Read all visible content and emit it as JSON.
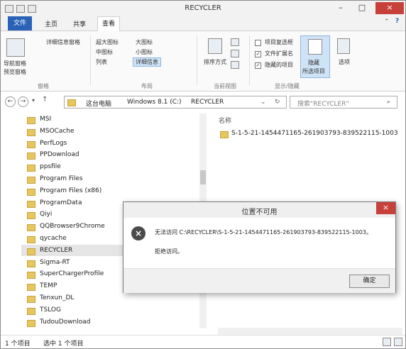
{
  "window": {
    "title": "RECYCLER",
    "min_label": "–",
    "max_label": "□",
    "close_label": "×"
  },
  "ribbon_tabs": {
    "file": "文件",
    "home": "主页",
    "share": "共享",
    "view": "查看"
  },
  "ribbon": {
    "nav_pane": "导航窗格",
    "preview_pane": "预览窗格",
    "details_pane": "详细信息窗格",
    "panes_group": "窗格",
    "layout": [
      "超大图标",
      "大图标",
      "中图标",
      "小图标",
      "列表",
      "详细信息"
    ],
    "layout_group": "布局",
    "sort_by": "排序方式",
    "current_view_group": "当前视图",
    "checkbox_items": "项目复选框",
    "file_extensions": "文件扩展名",
    "hidden_items": "隐藏的项目",
    "hide_label": "隐藏",
    "hide_selected": "所选项目",
    "options": "选项",
    "show_hide_group": "显示/隐藏"
  },
  "address": {
    "breadcrumb": [
      "这台电脑",
      "Windows 8.1 (C:)",
      "RECYCLER"
    ],
    "search_placeholder": "搜索\"RECYCLER\""
  },
  "nav_items": [
    "MSI",
    "MSOCache",
    "PerfLogs",
    "PPDownload",
    "ppsfile",
    "Program Files",
    "Program Files (x86)",
    "ProgramData",
    "Qiyi",
    "QQBrowser9Chrome",
    "qycache",
    "RECYCLER",
    "Sigma-RT",
    "SuperChargerProfile",
    "TEMP",
    "Tenxun_DL",
    "TSLOG",
    "TudouDownload"
  ],
  "content": {
    "column_header": "名称",
    "file": "S-1-5-21-1454471165-261903793-839522115-1003"
  },
  "status": {
    "count": "1 个项目",
    "selected": "选中 1 个项目"
  },
  "dialog": {
    "title": "位置不可用",
    "message": "无法访问 C:\\RECYCLER\\S-1-5-21-1454471165-261903793-839522115-1003。",
    "sub": "拒绝访问。",
    "ok": "确定",
    "icon": "error-icon"
  },
  "colors": {
    "file_tab": "#2a62b8",
    "close": "#c7403a",
    "folder": "#e7c65e"
  }
}
